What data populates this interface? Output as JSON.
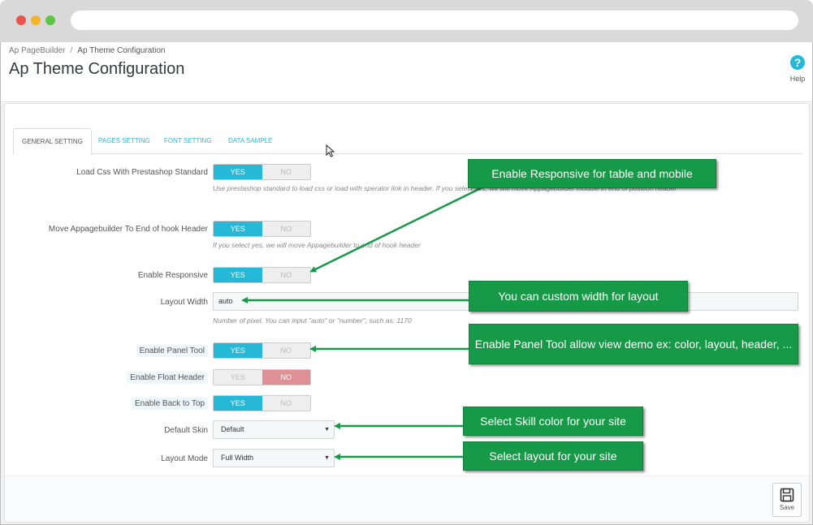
{
  "breadcrumb": {
    "parent": "Ap PageBuilder",
    "separator": "/",
    "current": "Ap Theme Configuration"
  },
  "page_title": "Ap Theme Configuration",
  "help": {
    "icon": "?",
    "label": "Help"
  },
  "tabs": [
    {
      "label": "GENERAL SETTING",
      "active": true
    },
    {
      "label": "PAGES SETTING",
      "active": false
    },
    {
      "label": "FONT SETTING",
      "active": false
    },
    {
      "label": "DATA SAMPLE",
      "active": false
    }
  ],
  "switch_labels": {
    "yes": "YES",
    "no": "NO"
  },
  "fields": {
    "load_css": {
      "label": "Load Css With Prestashop Standard",
      "value": "YES",
      "hint": "Use prestashop standard to load css or load with sperator link in header. If you select yes, we will move Appagebuilder module in end of position header"
    },
    "move_appagebuilder": {
      "label": "Move Appagebuilder To End of hook Header",
      "value": "YES",
      "hint": "If you select yes, we will move Appagebuilder to end of hook header"
    },
    "enable_responsive": {
      "label": "Enable Responsive",
      "value": "YES"
    },
    "layout_width": {
      "label": "Layout Width",
      "value": "auto",
      "hint": "Number of pixel. You can input \"auto\" or \"number\", such as: 1170"
    },
    "enable_panel_tool": {
      "label": "Enable Panel Tool",
      "value": "YES"
    },
    "enable_float_header": {
      "label": "Enable Float Header",
      "value": "NO"
    },
    "enable_back_to_top": {
      "label": "Enable Back to Top",
      "value": "YES"
    },
    "default_skin": {
      "label": "Default Skin",
      "value": "Default"
    },
    "layout_mode": {
      "label": "Layout Mode",
      "value": "Full Width"
    }
  },
  "save_button": {
    "label": "Save"
  },
  "callouts": {
    "responsive": "Enable Responsive for table and mobile",
    "width": "You can custom width for layout",
    "panel_tool": "Enable Panel Tool allow view demo ex: color, layout, header, ...",
    "skin": "Select Skill color for your site",
    "layout": "Select layout for your site"
  },
  "colors": {
    "accent": "#25b9d7",
    "no_active": "#e08f95",
    "callout": "#179a47",
    "close_dot": "#e9544e",
    "min_dot": "#f2b62c",
    "max_dot": "#5ec544"
  }
}
